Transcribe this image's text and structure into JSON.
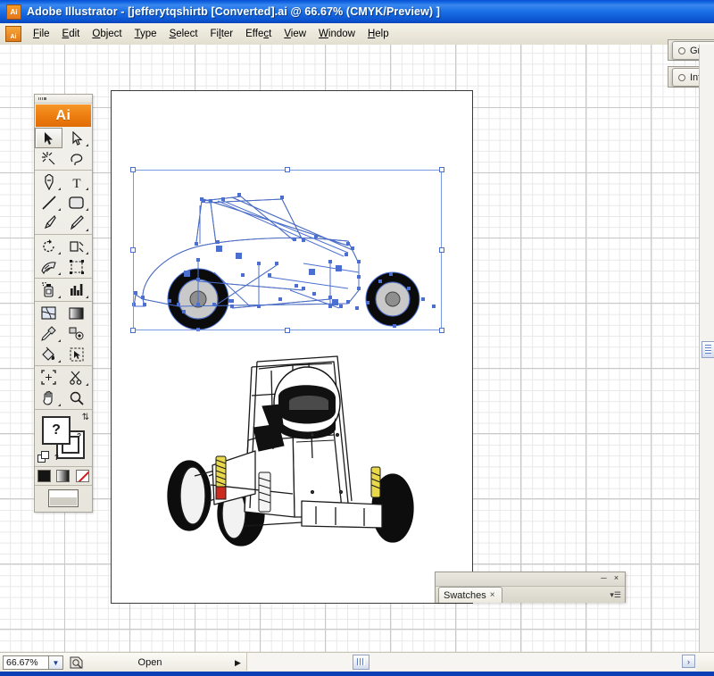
{
  "window": {
    "app_name": "Adobe Illustrator",
    "title": "Adobe Illustrator - [jefferytqshirtb [Converted].ai @ 66.67% (CMYK/Preview) ]",
    "document_name": "jefferytqshirtb [Converted].ai",
    "zoom_in_title": "66.67%",
    "color_mode": "CMYK/Preview",
    "app_badge_label": "Ai"
  },
  "menubar": {
    "items": [
      {
        "label": "File",
        "accel": "F"
      },
      {
        "label": "Edit",
        "accel": "E"
      },
      {
        "label": "Object",
        "accel": "O"
      },
      {
        "label": "Type",
        "accel": "T"
      },
      {
        "label": "Select",
        "accel": "S"
      },
      {
        "label": "Filter",
        "accel": "l"
      },
      {
        "label": "Effect",
        "accel": "c"
      },
      {
        "label": "View",
        "accel": "V"
      },
      {
        "label": "Window",
        "accel": "W"
      },
      {
        "label": "Help",
        "accel": "H"
      }
    ]
  },
  "toolpanel": {
    "logo_label": "Ai",
    "tools": [
      {
        "name": "selection-tool",
        "label": "Selection",
        "selected": true,
        "more": false
      },
      {
        "name": "direct-selection-tool",
        "label": "Direct Selection",
        "selected": false,
        "more": true
      },
      {
        "name": "magic-wand-tool",
        "label": "Magic Wand",
        "selected": false,
        "more": false
      },
      {
        "name": "lasso-tool",
        "label": "Lasso",
        "selected": false,
        "more": false
      },
      {
        "name": "pen-tool",
        "label": "Pen",
        "selected": false,
        "more": true
      },
      {
        "name": "type-tool",
        "label": "Type",
        "selected": false,
        "more": true
      },
      {
        "name": "line-segment-tool",
        "label": "Line Segment",
        "selected": false,
        "more": true
      },
      {
        "name": "rectangle-tool",
        "label": "Rectangle",
        "selected": false,
        "more": true
      },
      {
        "name": "paintbrush-tool",
        "label": "Paintbrush",
        "selected": false,
        "more": false
      },
      {
        "name": "pencil-tool",
        "label": "Pencil",
        "selected": false,
        "more": true
      },
      {
        "name": "rotate-tool",
        "label": "Rotate",
        "selected": false,
        "more": true
      },
      {
        "name": "scale-tool",
        "label": "Scale",
        "selected": false,
        "more": true
      },
      {
        "name": "warp-tool",
        "label": "Warp",
        "selected": false,
        "more": true
      },
      {
        "name": "free-transform-tool",
        "label": "Free Transform",
        "selected": false,
        "more": false
      },
      {
        "name": "symbol-sprayer-tool",
        "label": "Symbol Sprayer",
        "selected": false,
        "more": true
      },
      {
        "name": "column-graph-tool",
        "label": "Column Graph",
        "selected": false,
        "more": true
      },
      {
        "name": "mesh-tool",
        "label": "Mesh",
        "selected": false,
        "more": false
      },
      {
        "name": "gradient-tool",
        "label": "Gradient",
        "selected": false,
        "more": false
      },
      {
        "name": "eyedropper-tool",
        "label": "Eyedropper",
        "selected": false,
        "more": true
      },
      {
        "name": "blend-tool",
        "label": "Blend",
        "selected": false,
        "more": false
      },
      {
        "name": "live-paint-bucket-tool",
        "label": "Live Paint Bucket",
        "selected": false,
        "more": true
      },
      {
        "name": "live-paint-selection-tool",
        "label": "Live Paint Selection",
        "selected": false,
        "more": false
      },
      {
        "name": "crop-area-tool",
        "label": "Crop Area",
        "selected": false,
        "more": false
      },
      {
        "name": "scissors-tool",
        "label": "Scissors",
        "selected": false,
        "more": true
      },
      {
        "name": "hand-tool",
        "label": "Hand",
        "selected": false,
        "more": true
      },
      {
        "name": "zoom-tool",
        "label": "Zoom",
        "selected": false,
        "more": false
      }
    ],
    "fill_stroke": {
      "fill_indicator": "?",
      "stroke_indicator": "?",
      "swap_icon": "swap-fill-stroke",
      "default_icon": "default-fill-stroke"
    },
    "color_modes": [
      {
        "name": "color-button",
        "label": "Color"
      },
      {
        "name": "gradient-button",
        "label": "Gradient"
      },
      {
        "name": "none-button",
        "label": "None"
      }
    ],
    "screen_mode": {
      "name": "screen-mode-button",
      "label": "Screen Mode"
    }
  },
  "panels": {
    "right_docked": [
      {
        "name": "gradient-panel-tab",
        "label": "Gradient"
      },
      {
        "name": "info-panel-tab",
        "label": "Info",
        "close": "×"
      }
    ],
    "swatches": {
      "tab_label": "Swatches",
      "tab_close": "×",
      "minimize": "─",
      "close": "×",
      "menu_icon": "panel-menu-icon"
    }
  },
  "statusbar": {
    "zoom_value": "66.67%",
    "zoom_dropdown_icon": "chevron-down-icon",
    "cursor_icon": "cursor-coordinates-icon",
    "status_text": "Open",
    "status_dropdown_icon": "triangle-right-icon",
    "prev_icon": "‹",
    "next_icon": "›"
  },
  "canvas": {
    "artboard_label": "artboard",
    "grid_visible": true,
    "selection": {
      "active": true,
      "object_label": "sprint-car-side-view",
      "handle_color": "#ffffff",
      "bbox_color": "#7c9ae0",
      "anchor_color": "#4a6fd0"
    },
    "artworks": [
      {
        "name": "sprint-car-side-view-artwork",
        "label": "Sprint car side view (selected vector paths)"
      },
      {
        "name": "sprint-car-three-quarter-artwork",
        "label": "Sprint car three-quarter front view with driver"
      }
    ]
  },
  "colors": {
    "titlebar_blue": "#1a6fe6",
    "ai_orange": "#ef8012",
    "panel_beige": "#ece9dc",
    "selection_blue": "#4a6fd0",
    "artboard_border": "#3a3a3a"
  }
}
